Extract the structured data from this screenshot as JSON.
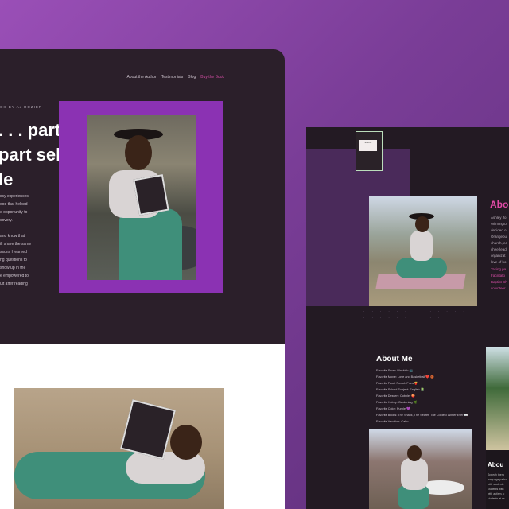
{
  "left_page": {
    "nav": [
      {
        "label": "About the Author"
      },
      {
        "label": "Testimonials"
      },
      {
        "label": "Blog"
      },
      {
        "label": "Buy the Book"
      }
    ],
    "byline": "OK BY AJ ROZIER",
    "hero_lines": [
      ". . . part",
      "part self-",
      "le"
    ],
    "body_lines": [
      "ssy experiences",
      "ood that helped",
      "e opportunity to",
      "covery.",
      "",
      "and know that",
      "ill share the same",
      "ssons I learned",
      "ng questions to",
      "show up in the",
      "e empowered to",
      "ult after reading"
    ]
  },
  "right_page": {
    "thumb_text": "that is.",
    "about_side": "Abo",
    "side_text_lines": [
      "Ashley Jo",
      "Wilmingto",
      "decided o",
      "Orangebu",
      "church, ea",
      "cheerlead",
      "organizat",
      "love of bo"
    ],
    "side_link_lines": [
      "Taking pa",
      "Facilitato",
      "Baptist Ch",
      "volunteer"
    ],
    "dots_text": "· · · · · · · · · · · · · · · · · · · · · · · ·",
    "about_me_title": "About Me",
    "facts": [
      "Favorite Show: Blackish 📺",
      "Favorite Movie: Love and Basketball ❤️ 🏀",
      "Favorite Food: French Fries 🍟",
      "Favorite School Subject: English 📗",
      "Favorite Dessert: Cobbler 🍑",
      "Favorite Hobby: Gardening 🌿",
      "Favorite Color: Purple 💜",
      "Favorite Books: The Shack, The Secret, The Coldest Winter Ever 📖",
      "Favorite Vacation: Cabo"
    ],
    "card_title": "Abou",
    "card_text_lines": [
      "Speech thera",
      "language patho",
      "with students",
      "students with",
      "with autism, c",
      "students at ris"
    ]
  },
  "colors": {
    "background": "#8a45a8",
    "accent_pink": "#d64ea6",
    "frame_purple": "#8b32b3",
    "dark": "#2b1f2a"
  }
}
